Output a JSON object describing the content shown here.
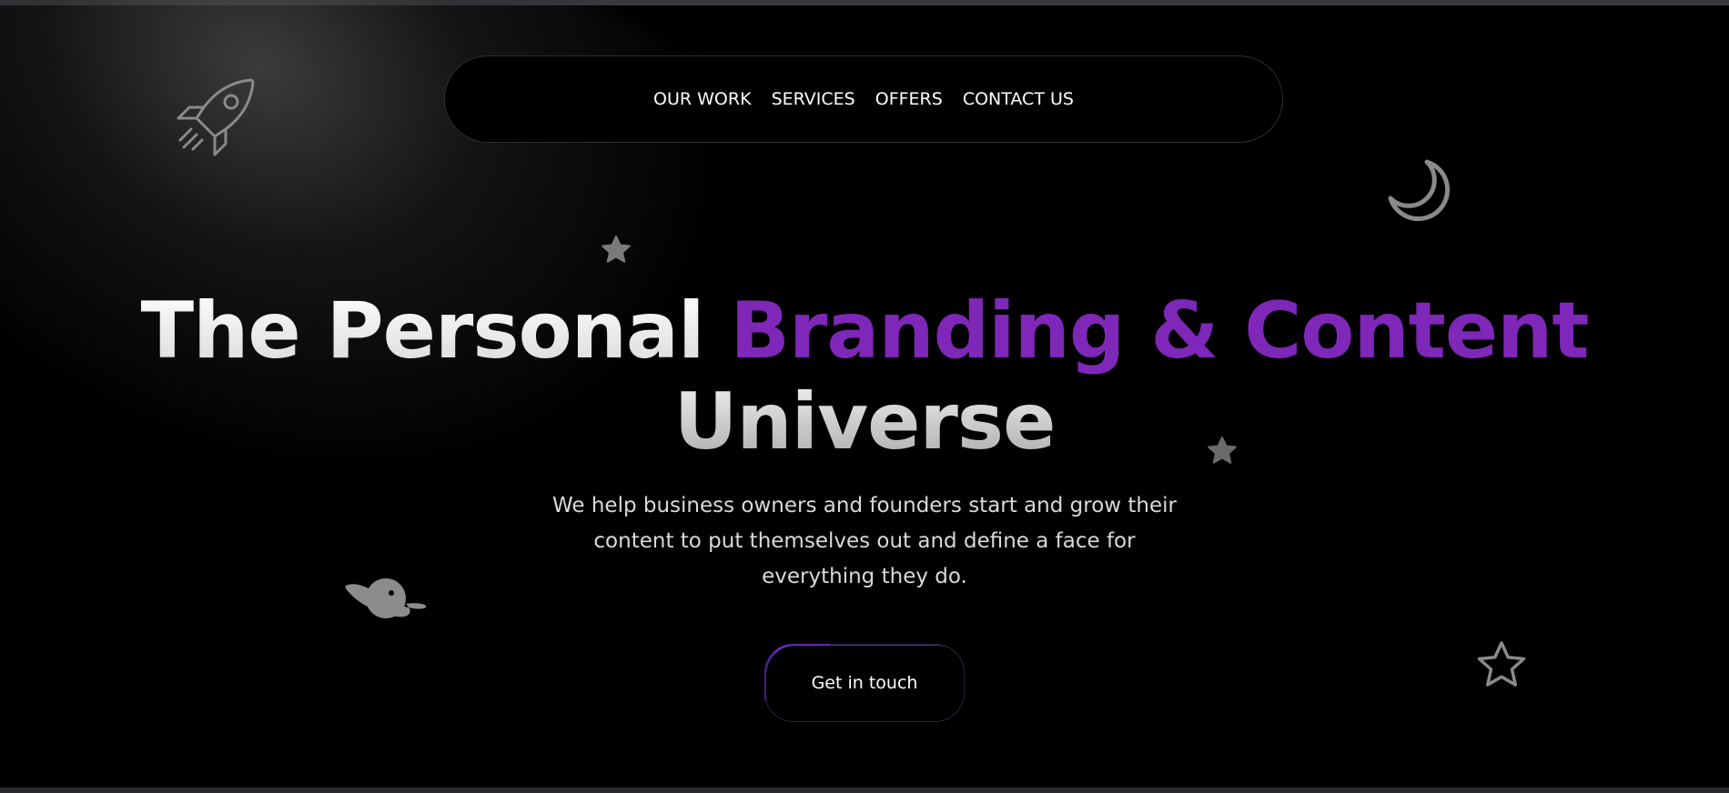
{
  "nav": {
    "items": [
      {
        "label": "OUR WORK"
      },
      {
        "label": "SERVICES"
      },
      {
        "label": "OFFERS"
      },
      {
        "label": "CONTACT US"
      }
    ]
  },
  "hero": {
    "headline_white": "The Personal ",
    "headline_purple": "Branding & Content",
    "headline_line2": "Universe",
    "subtext": "We help business owners and founders start and grow their content to put themselves out and define a face for everything they do.",
    "cta_label": "Get in touch"
  },
  "decorations": {
    "icons": [
      "rocket-icon",
      "moon-icon",
      "star-icon",
      "planet-icon",
      "star-outline-icon"
    ]
  },
  "colors": {
    "background": "#000000",
    "accent_purple": "#7e27b8",
    "text_primary": "#ffffff",
    "text_secondary": "#d9d9d9",
    "icon_grey": "#8a8a8a"
  }
}
